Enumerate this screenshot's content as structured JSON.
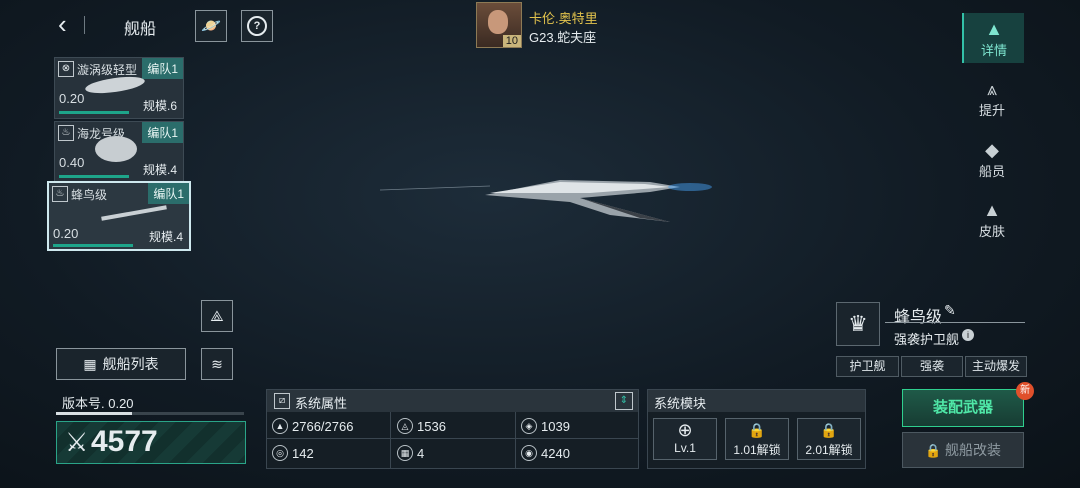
{
  "header": {
    "title": "舰船"
  },
  "commander": {
    "name": "卡伦.奥特里",
    "level": "10",
    "location": "G23.蛇夫座"
  },
  "ships": [
    {
      "name": "漩涡级轻型",
      "tag": "编队1",
      "value": "0.20",
      "scale": "规模.6",
      "icon": "x-circle-icon"
    },
    {
      "name": "海龙号级",
      "tag": "编队1",
      "value": "0.40",
      "scale": "规模.4",
      "icon": "flame-icon"
    },
    {
      "name": "蜂鸟级",
      "tag": "编队1",
      "value": "0.20",
      "scale": "规模.4",
      "icon": "flame-icon"
    }
  ],
  "nav": [
    {
      "label": "详情",
      "icon": "ship-icon",
      "active": true
    },
    {
      "label": "提升",
      "icon": "upgrade-icon"
    },
    {
      "label": "船员",
      "icon": "crew-icon"
    },
    {
      "label": "皮肤",
      "icon": "skin-icon"
    }
  ],
  "ship_list_label": "舰船列表",
  "version": {
    "label": "版本号. 0.20"
  },
  "power": "4577",
  "attributes": {
    "title": "系统属性",
    "values": [
      "2766/2766",
      "1536",
      "1039",
      "142",
      "4",
      "4240"
    ]
  },
  "modules": {
    "title": "系统模块",
    "items": [
      "Lv.1",
      "1.01解锁",
      "2.01解锁"
    ]
  },
  "ship_info": {
    "name": "蜂鸟级",
    "class": "强袭护卫舰",
    "tags": [
      "护卫舰",
      "强袭",
      "主动爆发"
    ]
  },
  "actions": {
    "equip": "装配武器",
    "modify": "舰船改装",
    "new_badge": "新"
  }
}
